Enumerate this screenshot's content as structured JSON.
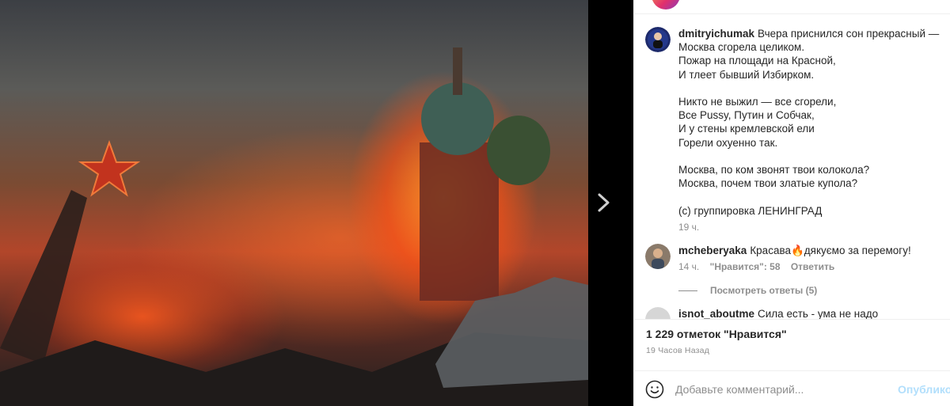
{
  "post": {
    "author": "dmitryichumak",
    "caption_lines": [
      "Вчера приснился сон прекрасный —",
      "Москва сгорела целиком.",
      "Пожар на площади на Красной,",
      "И тлеет бывший Избирком.",
      "",
      "Никто не выжил — все сгорели,",
      "Все Pussy, Путин и Собчак,",
      "И у стены кремлевской ели",
      "Горели охуенно так.",
      "",
      "Москва, по ком звонят твои колокола?",
      "Москва, почем твои златые купола?",
      "",
      "(с) группировка ЛЕНИНГРАД"
    ],
    "time": "19 ч."
  },
  "comments": [
    {
      "username": "mcheberyaka",
      "text": "Красава🔥дякуємо за перемогу!",
      "time": "14 ч.",
      "likes": "\"Нравится\": 58",
      "reply": "Ответить",
      "view_replies": "Посмотреть ответы (5)"
    },
    {
      "username": "isnot_aboutme",
      "text": "Сила есть - ума не надо"
    }
  ],
  "actions": {
    "likes_total": "1 229 отметок \"Нравится\"",
    "timestamp": "19 Часов Назад"
  },
  "add_comment": {
    "placeholder": "Добавьте комментарий...",
    "publish": "Опублико"
  },
  "icons": {
    "next": "chevron-right-icon",
    "emoji": "smiley-icon"
  },
  "colors": {
    "link_blue_disabled": "#b2dffc",
    "muted": "#8e8e8e",
    "text": "#262626"
  }
}
